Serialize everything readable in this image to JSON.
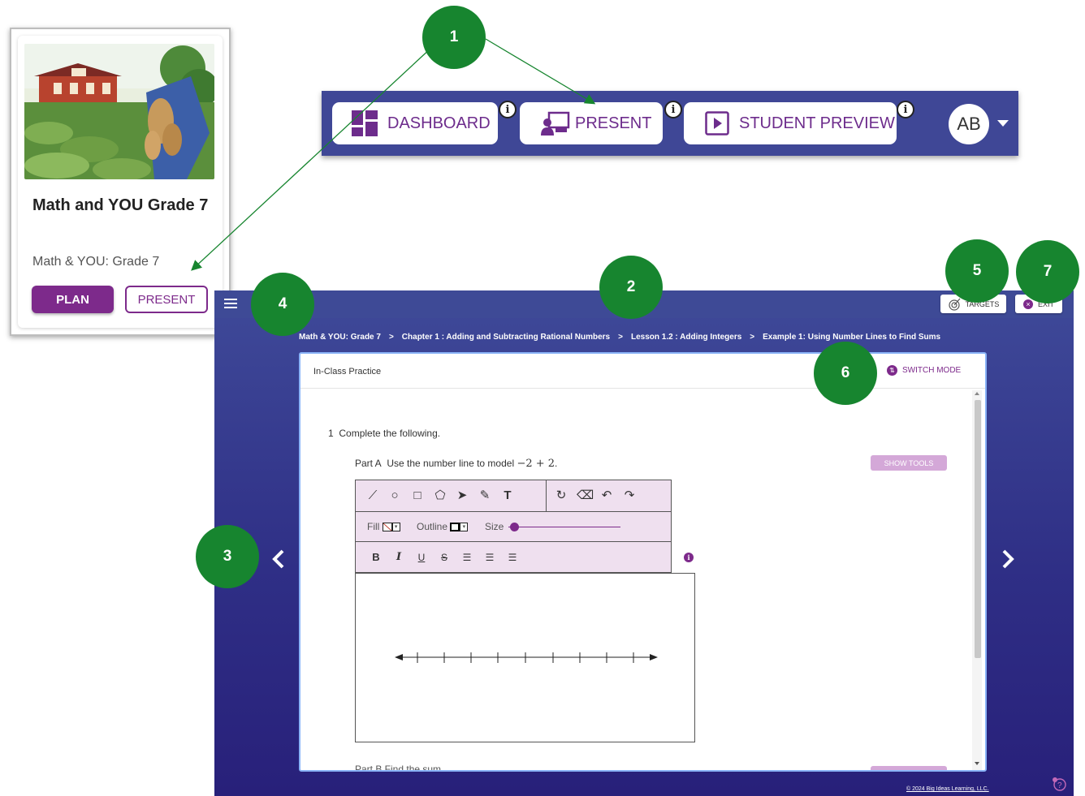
{
  "course_card": {
    "title": "Math and YOU Grade 7",
    "subtitle": "Math & YOU: Grade 7",
    "plan_label": "PLAN",
    "present_label": "PRESENT"
  },
  "navbar": {
    "dashboard_label": "DASHBOARD",
    "present_label": "PRESENT",
    "student_preview_label": "STUDENT PREVIEW",
    "info_glyph": "i",
    "avatar_initials": "AB"
  },
  "presenter": {
    "targets_label": "TARGETS",
    "exit_label": "EXIT",
    "breadcrumb": [
      "Math & YOU: Grade 7",
      "Chapter 1 : Adding and Subtracting Rational Numbers",
      "Lesson 1.2 : Adding Integers",
      "Example 1: Using Number Lines to Find Sums"
    ],
    "breadcrumb_separator": ">",
    "panel_title": "In-Class Practice",
    "switch_mode_label": "SWITCH MODE",
    "question_number": "1",
    "question_text": "Complete the following.",
    "part_a_label": "Part A",
    "part_a_text": "Use the number line to model",
    "part_a_math": "−2 + 2",
    "part_a_end": ".",
    "show_tools_label": "SHOW TOOLS",
    "part_b_text": "Part B  Find the sum.",
    "toolbar": {
      "fill_label": "Fill",
      "outline_label": "Outline",
      "size_label": "Size",
      "size_level": 0.05
    },
    "copyright": "© 2024 Big Ideas Learning, LLC."
  },
  "callouts": [
    "1",
    "2",
    "3",
    "4",
    "5",
    "6",
    "7"
  ],
  "colors": {
    "brand_purple": "#7d2a8b",
    "nav_blue": "#3f4796",
    "callout_green": "#17852f"
  }
}
